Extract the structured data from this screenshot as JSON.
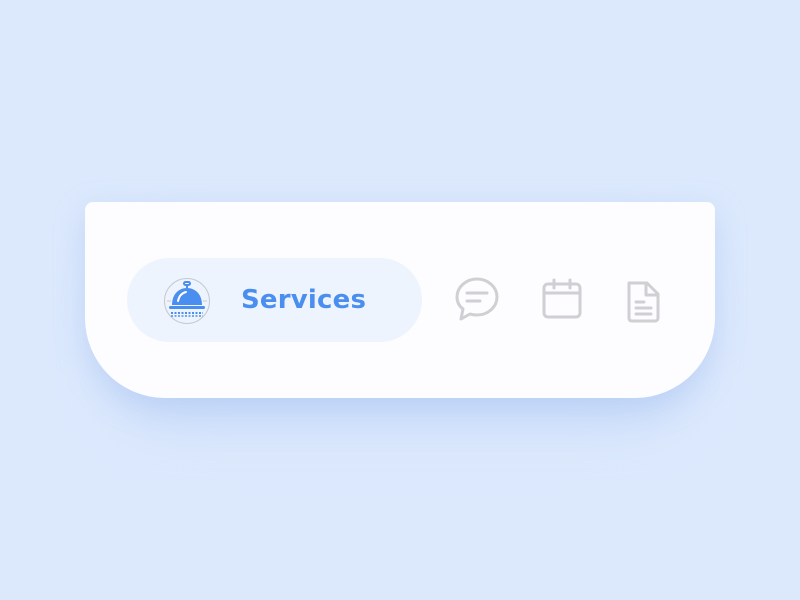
{
  "tabbar": {
    "active_tab": {
      "label": "Services",
      "icon": "service-bell-icon"
    },
    "tabs": [
      {
        "icon": "chat-bubble-icon"
      },
      {
        "icon": "calendar-icon"
      },
      {
        "icon": "document-icon"
      }
    ]
  },
  "colors": {
    "background": "#dce9fd",
    "bar": "#fdfdff",
    "active_pill": "#eef4fe",
    "accent": "#4a8ef0",
    "inactive_icon": "#d0d0d4"
  }
}
